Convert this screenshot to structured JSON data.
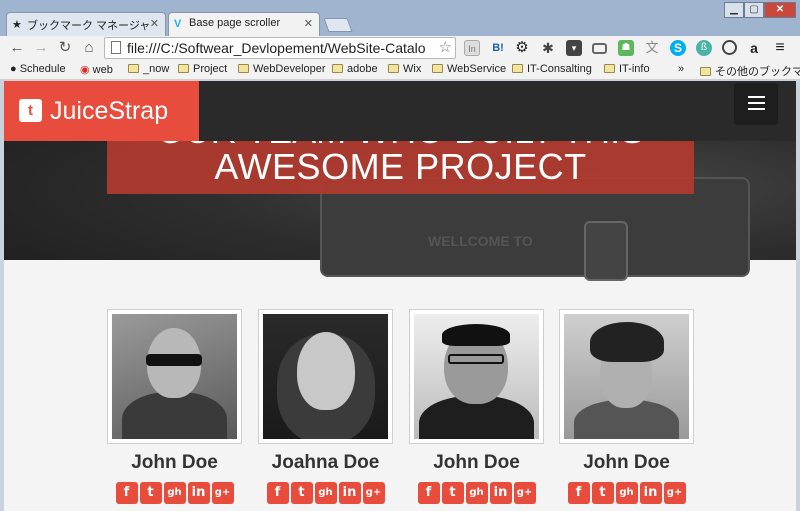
{
  "browser": {
    "tabs": [
      {
        "label": "ブックマーク マネージャ",
        "icon": "star-icon",
        "active": false
      },
      {
        "label": "Base page scroller",
        "icon": "vimeo-icon",
        "active": true
      }
    ],
    "address": "file:///C:/Softwear_Devlopement/WebSite-Catalo",
    "bookmarks": [
      "Schedule",
      "web",
      "_now",
      "Project",
      "WebDeveloper",
      "adobe",
      "Wix",
      "WebService",
      "IT-Consalting",
      "IT-info"
    ],
    "overflow": "»",
    "other_bookmarks": "その他のブックマーク",
    "extensions": [
      "In",
      "B!"
    ]
  },
  "page": {
    "brand": "JuiceStrap",
    "brand_icon": "twitter-icon",
    "hero_title": "AWESOME PROJECT",
    "hero_title_cut": "OUR TEAM WHO BUILT THIS",
    "hero_ghost": "WELLCOME TO",
    "accent_color": "#e74c3c",
    "members": [
      {
        "name": "John Doe"
      },
      {
        "name": "Joahna Doe"
      },
      {
        "name": "John Doe"
      },
      {
        "name": "John Doe"
      }
    ],
    "social_icons": [
      "f",
      "t",
      "gh",
      "in",
      "g+"
    ]
  }
}
